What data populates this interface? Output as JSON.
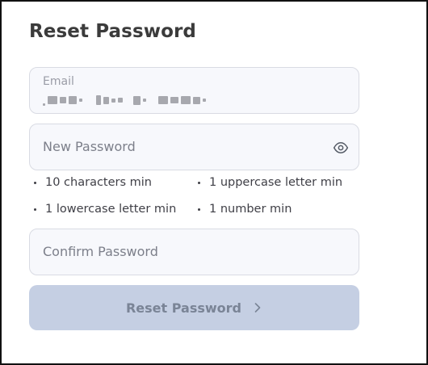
{
  "page": {
    "title": "Reset Password"
  },
  "email": {
    "label": "Email",
    "value": "•••••• •••• •• ••••••"
  },
  "new_password": {
    "placeholder": "New Password"
  },
  "rules": [
    {
      "label": "10 characters min"
    },
    {
      "label": "1 uppercase letter min"
    },
    {
      "label": "1 lowercase letter min"
    },
    {
      "label": "1 number min"
    }
  ],
  "confirm_password": {
    "placeholder": "Confirm Password"
  },
  "submit": {
    "label": "Reset Password"
  },
  "colors": {
    "field_bg": "#f7f8fc",
    "field_border": "#d9dbe3",
    "button_bg": "#c5cfe3",
    "button_text": "#7a8496"
  },
  "icons": {
    "show_password": "eye-icon",
    "submit_arrow": "chevron-right-icon"
  }
}
